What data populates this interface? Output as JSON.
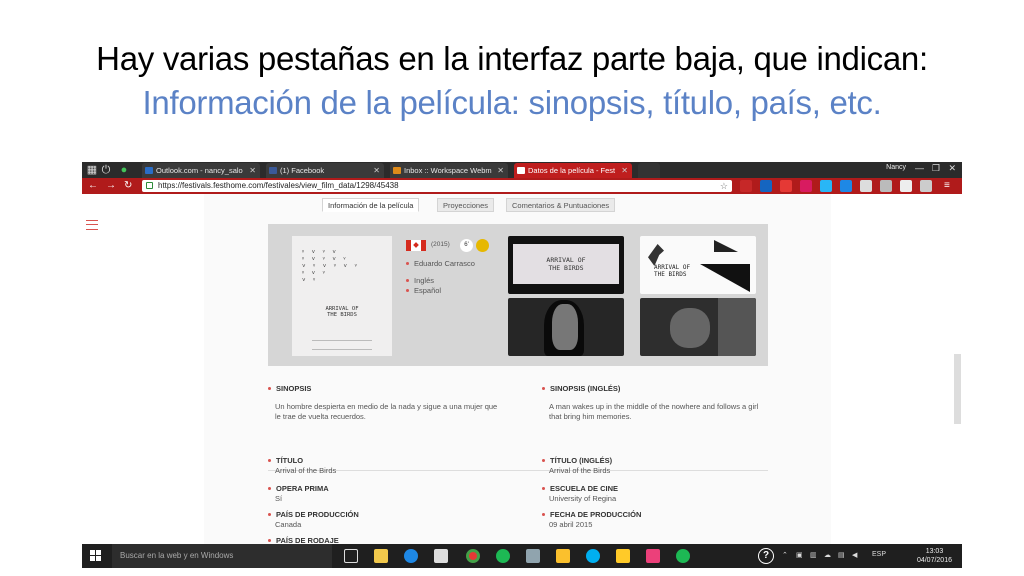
{
  "slide": {
    "heading": "Hay varias pestañas en la interfaz parte baja, que indican:",
    "subheading": "Información de la película: sinopsis, título, país, etc."
  },
  "browser": {
    "tabs": [
      {
        "label": "Outlook.com - nancy_salo",
        "favicon_color": "#2a6dc6"
      },
      {
        "label": "(1) Facebook",
        "favicon_color": "#3b5998"
      },
      {
        "label": "Inbox :: Workspace Webm",
        "favicon_color": "#e08b1a"
      },
      {
        "label": "Datos de la película - Fest",
        "favicon_color": "#ffffff",
        "active": true
      }
    ],
    "user": "Nancy",
    "url": "https://festivals.festhome.com/festivales/view_film_data/1298/45438",
    "icons": {
      "back": "back-arrow-icon",
      "forward": "forward-arrow-icon",
      "reload": "reload-icon",
      "lock": "lock-icon",
      "bookmark": "star-icon"
    },
    "accent": "#b01b1b"
  },
  "page": {
    "tabs": [
      "Información de la película",
      "Proyecciones",
      "Comentarios & Puntuaciones"
    ],
    "film": {
      "year": "(2015)",
      "rating_badge": "6'",
      "director": "Eduardo Carrasco",
      "languages": [
        "Inglés",
        "Español"
      ],
      "poster_title": "ARRIVAL OF\nTHE BIRDS",
      "still_1_title": "ARRIVAL OF\nTHE BIRDS",
      "still_2_title": "ARRIVAL OF\nTHE BIRDS"
    },
    "sections": {
      "sinopsis_label": "SINOPSIS",
      "sinopsis_text": "Un hombre despierta en medio de la nada y sigue a una mujer que le trae de vuelta recuerdos.",
      "sinopsis_en_label": "SINOPSIS (INGLÉS)",
      "sinopsis_en_text": "A man wakes up in the middle of the nowhere and follows a girl that bring him memories.",
      "titulo_label": "TÍTULO",
      "titulo_value": "Arrival of the Birds",
      "titulo_en_label": "TÍTULO (INGLÉS)",
      "titulo_en_value": "Arrival of the Birds",
      "opera_label": "OPERA PRIMA",
      "opera_value": "Sí",
      "escuela_label": "ESCUELA DE CINE",
      "escuela_value": "University of Regina",
      "pais_label": "PAÍS DE PRODUCCIÓN",
      "pais_value": "Canada",
      "fecha_label": "FECHA DE PRODUCCIÓN",
      "fecha_value": "09 abril 2015",
      "rodaje_label": "PAÍS DE RODAJE"
    }
  },
  "taskbar": {
    "search_placeholder": "Buscar en la web y en Windows",
    "lang": "ESP",
    "time": "13:03",
    "date": "04/07/2016"
  }
}
